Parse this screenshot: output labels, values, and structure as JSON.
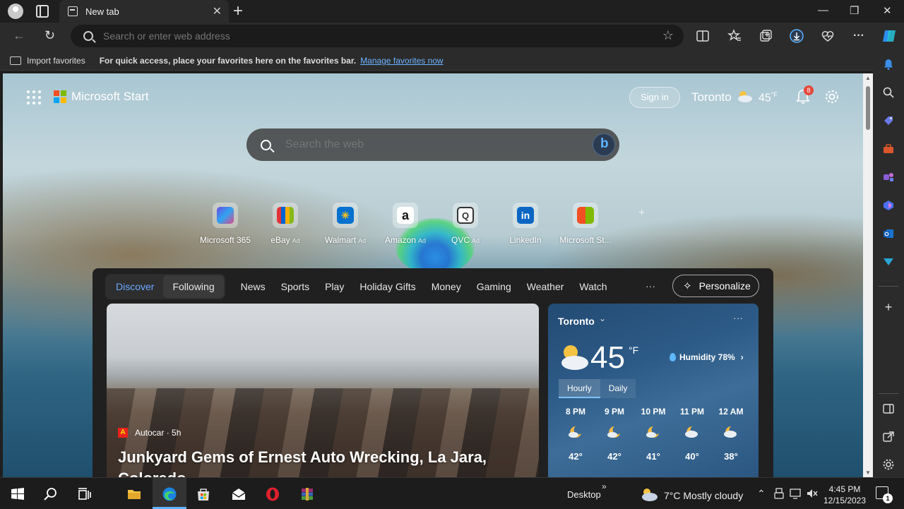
{
  "browser": {
    "tab_title": "New tab",
    "address_placeholder": "Search or enter web address",
    "favorites_bar": {
      "import_label": "Import favorites",
      "hint": "For quick access, place your favorites here on the favorites bar.",
      "manage_link": "Manage favorites now"
    }
  },
  "start": {
    "brand": "Microsoft Start",
    "sign_in": "Sign in",
    "header_weather": {
      "city": "Toronto",
      "temp": "45",
      "unit": "°F"
    },
    "notifications_count": "8",
    "search_placeholder": "Search the web",
    "quick_links": [
      {
        "label": "Microsoft 365",
        "ad": "",
        "icon": "microsoft-365-icon"
      },
      {
        "label": "eBay",
        "ad": "Ad",
        "icon": "ebay-icon"
      },
      {
        "label": "Walmart",
        "ad": "Ad",
        "icon": "walmart-icon"
      },
      {
        "label": "Amazon",
        "ad": "Ad",
        "icon": "amazon-icon"
      },
      {
        "label": "QVC",
        "ad": "Ad",
        "icon": "qvc-icon"
      },
      {
        "label": "LinkedIn",
        "ad": "",
        "icon": "linkedin-icon"
      },
      {
        "label": "Microsoft St...",
        "ad": "",
        "icon": "microsoft-store-icon"
      }
    ],
    "feed_tabs": {
      "discover": "Discover",
      "following": "Following"
    },
    "feed_nav": [
      "News",
      "Sports",
      "Play",
      "Holiday Gifts",
      "Money",
      "Gaming",
      "Weather",
      "Watch"
    ],
    "more": "···",
    "personalize": "Personalize",
    "news_card": {
      "source": "Autocar · 5h",
      "title": "Junkyard Gems of Ernest Auto Wrecking, La Jara, Colorado"
    },
    "weather_card": {
      "city": "Toronto",
      "temp": "45",
      "unit": "°F",
      "humidity": "Humidity 78%",
      "tabs": [
        "Hourly",
        "Daily"
      ],
      "hours": [
        {
          "time": "8 PM",
          "temp": "42°",
          "icon": "moon-cloud-icon"
        },
        {
          "time": "9 PM",
          "temp": "42°",
          "icon": "moon-cloud-icon"
        },
        {
          "time": "10 PM",
          "temp": "41°",
          "icon": "moon-cloud-icon"
        },
        {
          "time": "11 PM",
          "temp": "40°",
          "icon": "moon-cloud-icon"
        },
        {
          "time": "12 AM",
          "temp": "38°",
          "icon": "moon-cloud-icon"
        }
      ]
    }
  },
  "taskbar": {
    "desktop_label": "Desktop",
    "weather": "7°C  Mostly cloudy",
    "time": "4:45 PM",
    "date": "12/15/2023",
    "notification_count": "1"
  },
  "colors": {
    "accent": "#5fb3ff",
    "link": "#6cb4ff",
    "badge": "#e5493a"
  }
}
